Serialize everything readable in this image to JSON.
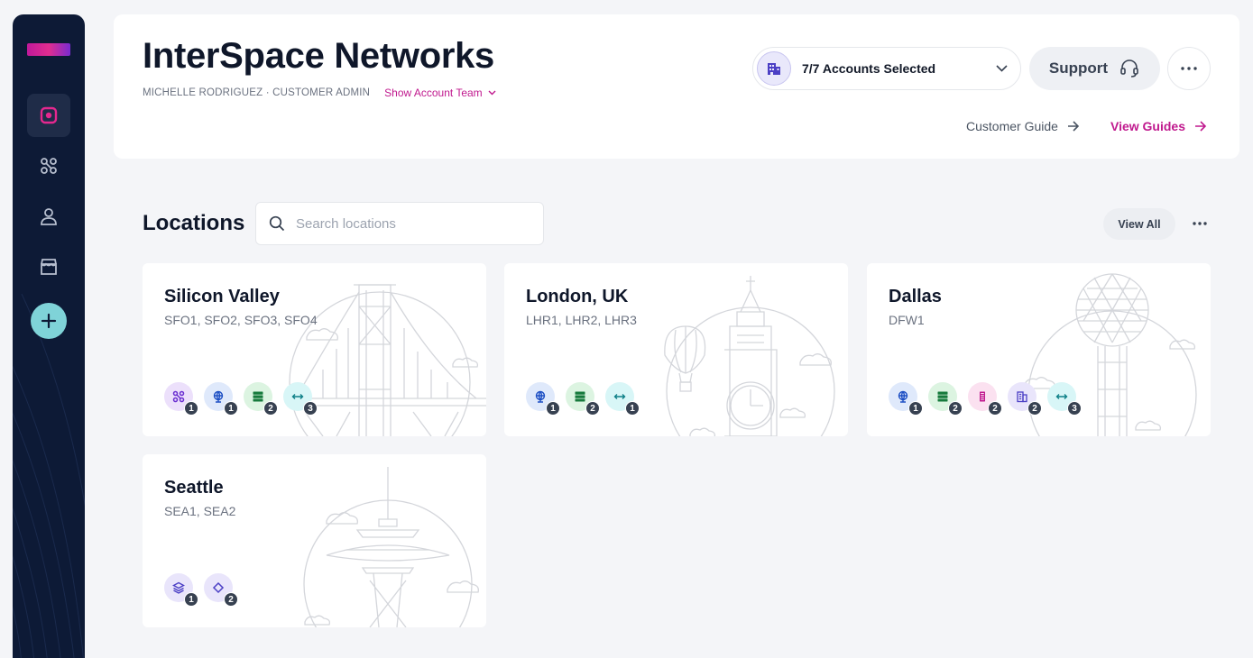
{
  "header": {
    "title": "InterSpace Networks",
    "user_role": "MICHELLE RODRIGUEZ · CUSTOMER ADMIN",
    "account_team_label": "Show Account Team",
    "accounts_label": "7/7 Accounts Selected",
    "support_label": "Support",
    "customer_guide_label": "Customer Guide",
    "view_guides_label": "View Guides"
  },
  "locations": {
    "title": "Locations",
    "search_placeholder": "Search locations",
    "view_all_label": "View All",
    "cards": [
      {
        "name": "Silicon Valley",
        "codes": "SFO1, SFO2, SFO3, SFO4",
        "badges": [
          {
            "icon": "connection-icon",
            "count": "1"
          },
          {
            "icon": "globe-icon",
            "count": "1"
          },
          {
            "icon": "server-icon",
            "count": "2"
          },
          {
            "icon": "cross-connect-icon",
            "count": "3"
          }
        ]
      },
      {
        "name": "London, UK",
        "codes": "LHR1, LHR2, LHR3",
        "badges": [
          {
            "icon": "globe-icon",
            "count": "1"
          },
          {
            "icon": "server-icon",
            "count": "2"
          },
          {
            "icon": "cross-connect-icon",
            "count": "1"
          }
        ]
      },
      {
        "name": "Dallas",
        "codes": "DFW1",
        "badges": [
          {
            "icon": "globe-icon",
            "count": "1"
          },
          {
            "icon": "server-icon",
            "count": "2"
          },
          {
            "icon": "cabinet-icon",
            "count": "2"
          },
          {
            "icon": "building-icon",
            "count": "2"
          },
          {
            "icon": "cross-connect-icon",
            "count": "3"
          }
        ]
      },
      {
        "name": "Seattle",
        "codes": "SEA1, SEA2",
        "badges": [
          {
            "icon": "layers-icon",
            "count": "1"
          },
          {
            "icon": "diamond-icon",
            "count": "2"
          }
        ]
      }
    ]
  },
  "colors": {
    "sidebar": "#0d1a36",
    "accent": "#c0198e",
    "add_button": "#7fd3d8"
  }
}
